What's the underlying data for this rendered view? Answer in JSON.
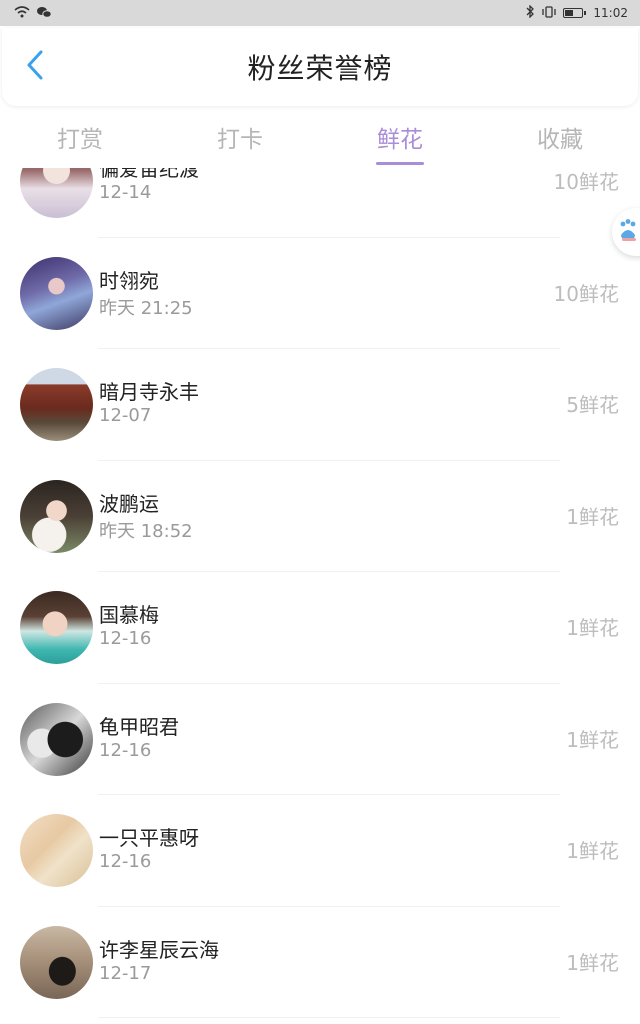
{
  "status_bar": {
    "time": "11:02",
    "left_icons": [
      "wifi-icon",
      "wechat-icon"
    ],
    "right_icons": [
      "bluetooth-icon",
      "vibrate-icon",
      "battery-icon"
    ]
  },
  "header": {
    "back_icon": "chevron-left-icon",
    "title": "粉丝荣誉榜"
  },
  "tabs": [
    {
      "label": "打赏",
      "active": false
    },
    {
      "label": "打卡",
      "active": false
    },
    {
      "label": "鲜花",
      "active": true
    },
    {
      "label": "收藏",
      "active": false
    }
  ],
  "colors": {
    "accent": "#a98dd6",
    "back_arrow": "#3aa0f0",
    "tab_inactive": "#b6b6b6",
    "count_text": "#bdbdbd"
  },
  "fans": [
    {
      "name": "偏爱宙纪渡",
      "time": "12-14",
      "count": "10鲜花"
    },
    {
      "name": "时翎宛",
      "time": "昨天 21:25",
      "count": "10鲜花"
    },
    {
      "name": "暗月寺永丰",
      "time": "12-07",
      "count": "5鲜花"
    },
    {
      "name": "波鹏运",
      "time": "昨天 18:52",
      "count": "1鲜花"
    },
    {
      "name": "国慕梅",
      "time": "12-16",
      "count": "1鲜花"
    },
    {
      "name": "龟甲昭君",
      "time": "12-16",
      "count": "1鲜花"
    },
    {
      "name": "一只平惠呀",
      "time": "12-16",
      "count": "1鲜花"
    },
    {
      "name": "许李星辰云海",
      "time": "12-17",
      "count": "1鲜花"
    }
  ],
  "floating_button": {
    "icon": "baidu-paw-icon"
  }
}
